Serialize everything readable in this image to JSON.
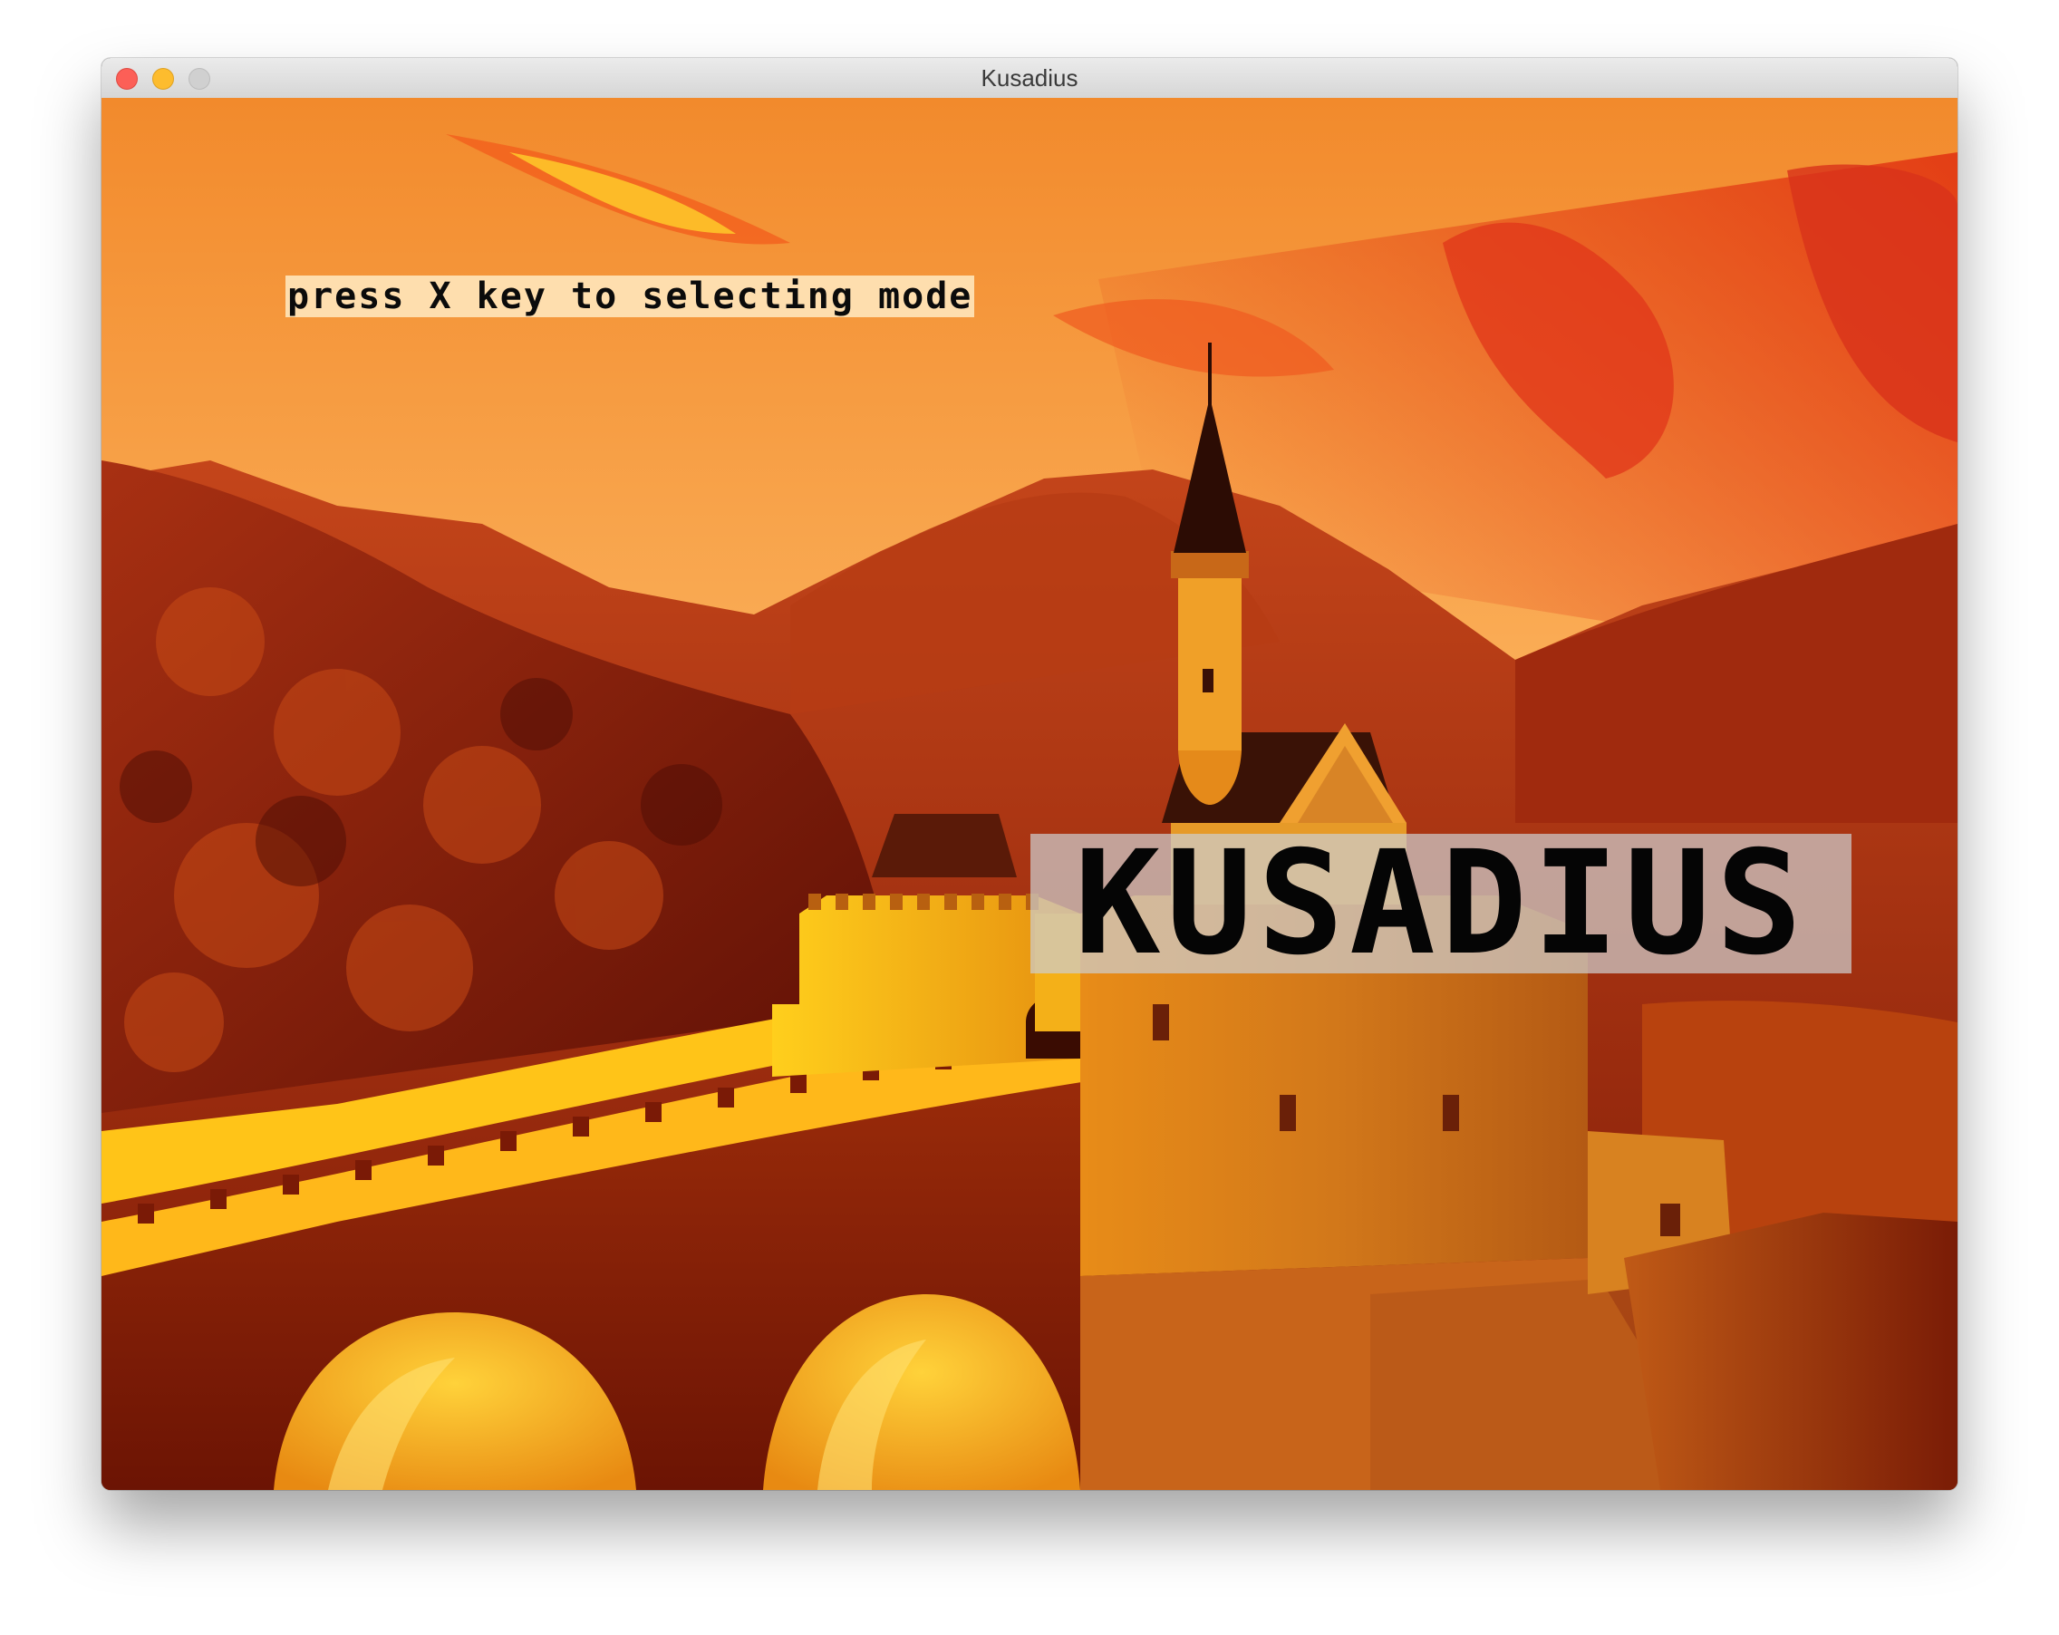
{
  "window": {
    "title": "Kusadius"
  },
  "game": {
    "hint": "press X key to selecting mode",
    "logo": "KUSADIUS",
    "background_icon": "castle-sunset-scene"
  },
  "colors": {
    "sky_top": "#f08a2a",
    "sky_mid": "#fbb45a",
    "mountains": "#8a1f08",
    "castle": "#f2a018",
    "highlight": "#ffd21a"
  }
}
